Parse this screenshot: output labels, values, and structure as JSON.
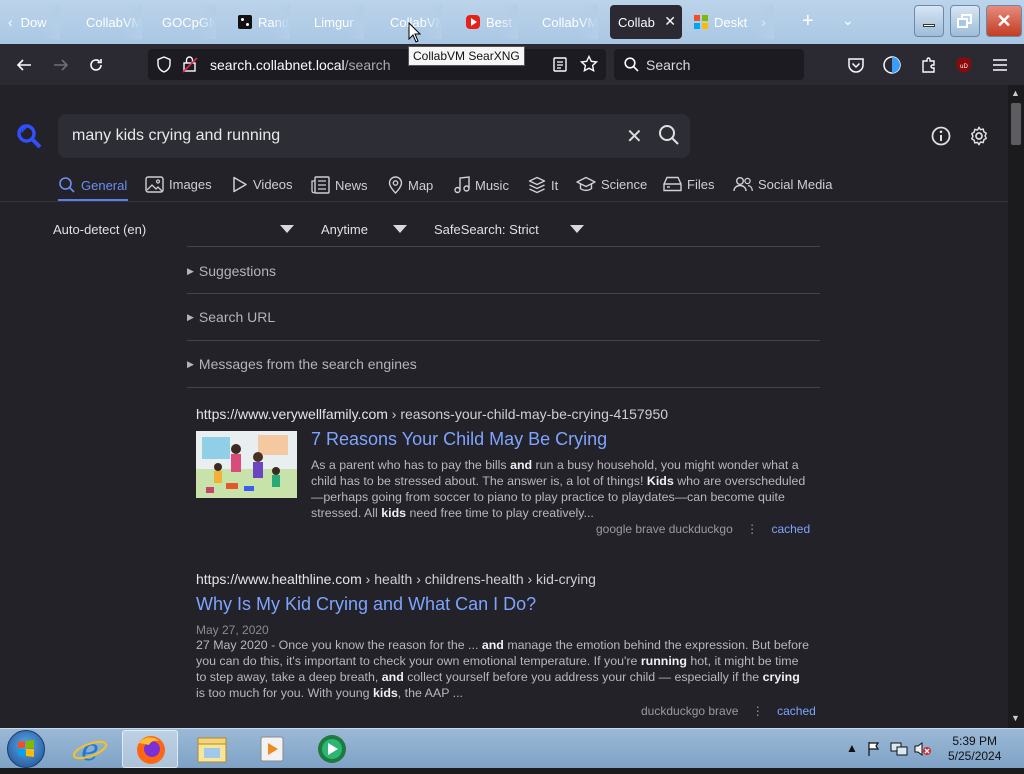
{
  "browser": {
    "tabs": [
      {
        "label": "Dow",
        "icon": "chevron-left-icon"
      },
      {
        "label": "CollabVM",
        "icon": ""
      },
      {
        "label": "GOCpGN",
        "icon": ""
      },
      {
        "label": "Rand",
        "icon": "dice-icon"
      },
      {
        "label": "Limgur",
        "icon": ""
      },
      {
        "label": "CollabVM",
        "icon": ""
      },
      {
        "label": "Best",
        "icon": "youtube-icon"
      },
      {
        "label": "CollabVM",
        "icon": ""
      },
      {
        "label": "Collab",
        "icon": "",
        "active": true
      },
      {
        "label": "Deskt",
        "icon": "microsoft-icon"
      }
    ],
    "tooltip": "CollabVM SearXNG",
    "url_host": "search.collabnet.local",
    "url_path": "/search",
    "search_placeholder": "Search"
  },
  "page": {
    "query": "many kids crying and running",
    "categories": [
      {
        "label": "General",
        "icon": "search-icon",
        "active": true
      },
      {
        "label": "Images",
        "icon": "image-icon"
      },
      {
        "label": "Videos",
        "icon": "play-icon"
      },
      {
        "label": "News",
        "icon": "newspaper-icon"
      },
      {
        "label": "Map",
        "icon": "map-pin-icon"
      },
      {
        "label": "Music",
        "icon": "music-icon"
      },
      {
        "label": "It",
        "icon": "layers-icon"
      },
      {
        "label": "Science",
        "icon": "graduation-cap-icon"
      },
      {
        "label": "Files",
        "icon": "drive-icon"
      },
      {
        "label": "Social Media",
        "icon": "users-icon"
      }
    ],
    "filters": {
      "language": "Auto-detect (en)",
      "time": "Anytime",
      "safesearch": "SafeSearch: Strict"
    },
    "sections": [
      "Suggestions",
      "Search URL",
      "Messages from the search engines"
    ],
    "results": [
      {
        "url": "https://www.verywellfamily.com",
        "path": " › reasons-your-child-may-be-crying-4157950",
        "title": "7 Reasons Your Child May Be Crying",
        "desc_parts": [
          [
            "As a parent who has to pay the bills ",
            false
          ],
          [
            "and",
            true
          ],
          [
            " run a busy household, you might wonder what a child has to be stressed about. The answer is, a lot of things! ",
            false
          ],
          [
            "Kids",
            true
          ],
          [
            " who are overscheduled—perhaps going from soccer to piano to play practice to playdates—can become quite stressed. All ",
            false
          ],
          [
            "kids",
            true
          ],
          [
            " need free time to play creatively...",
            false
          ]
        ],
        "engines": "google  brave  duckduckgo",
        "cached": "cached"
      },
      {
        "url": "https://www.healthline.com",
        "path": " › health › childrens-health › kid-crying",
        "title": "Why Is My Kid Crying and What Can I Do?",
        "date": "May 27, 2020",
        "desc_parts": [
          [
            "27 May 2020 - Once you know the reason for the ... ",
            false
          ],
          [
            "and",
            true
          ],
          [
            " manage the emotion behind the expression. But before you can do this, it's important to check your own emotional temperature. If you're ",
            false
          ],
          [
            "running",
            true
          ],
          [
            " hot, it might be time to step away, take a deep breath, ",
            false
          ],
          [
            "and",
            true
          ],
          [
            " collect yourself before you address your child — especially if the ",
            false
          ],
          [
            "crying",
            true
          ],
          [
            " is too much for you. With young ",
            false
          ],
          [
            "kids",
            true
          ],
          [
            ", the AAP ...",
            false
          ]
        ],
        "engines": "duckduckgo  brave",
        "cached": "cached"
      }
    ]
  },
  "taskbar": {
    "time": "5:39 PM",
    "date": "5/25/2024",
    "apps": [
      "ie-icon",
      "firefox-icon",
      "folder-icon",
      "media-player-icon",
      "collabvm-icon"
    ]
  }
}
